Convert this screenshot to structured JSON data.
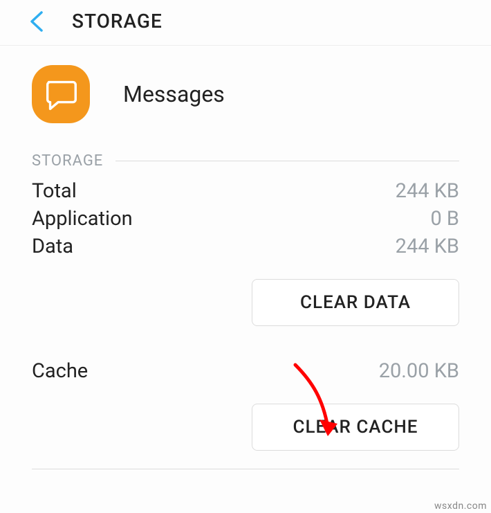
{
  "header": {
    "title": "STORAGE"
  },
  "app": {
    "name": "Messages"
  },
  "storage": {
    "section_label": "STORAGE",
    "rows": [
      {
        "key": "Total",
        "val": "244 KB"
      },
      {
        "key": "Application",
        "val": "0 B"
      },
      {
        "key": "Data",
        "val": "244 KB"
      }
    ],
    "clear_data_label": "CLEAR DATA"
  },
  "cache": {
    "key": "Cache",
    "val": "20.00 KB",
    "clear_cache_label": "CLEAR CACHE"
  },
  "watermark": "wsxdn.com",
  "colors": {
    "accent_blue": "#2faef0",
    "accent_orange": "#f4971c",
    "annotation_red": "#ff0000"
  }
}
